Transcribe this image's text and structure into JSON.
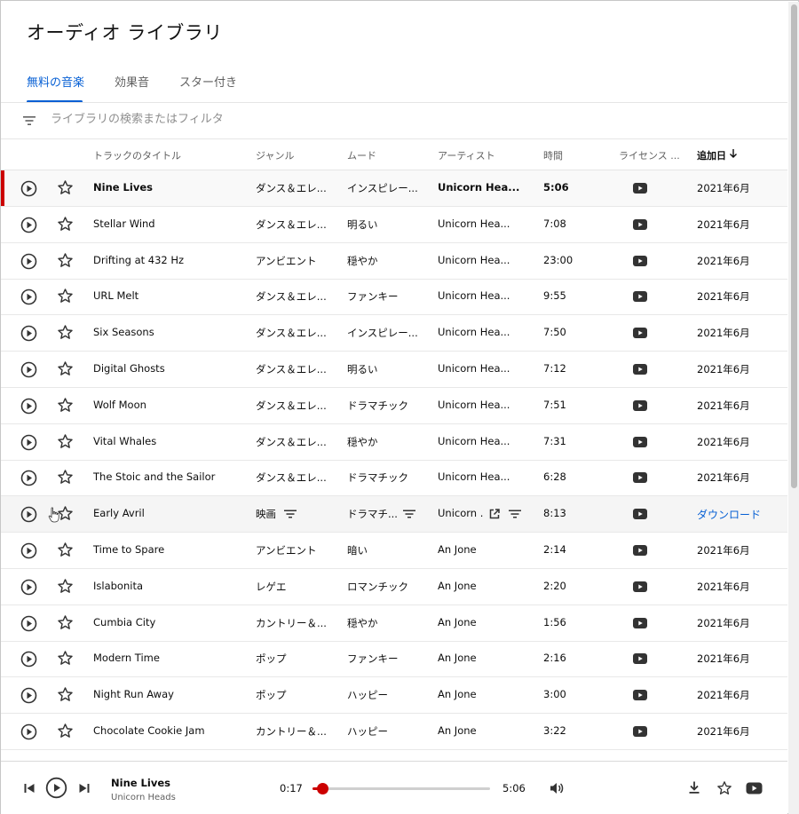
{
  "page": {
    "title": "オーディオ ライブラリ"
  },
  "tabs": [
    {
      "label": "無料の音楽",
      "active": true
    },
    {
      "label": "効果音",
      "active": false
    },
    {
      "label": "スター付き",
      "active": false
    }
  ],
  "filter": {
    "placeholder": "ライブラリの検索またはフィルタ"
  },
  "columns": {
    "title": "トラックのタイトル",
    "genre": "ジャンル",
    "mood": "ムード",
    "artist": "アーティスト",
    "duration": "時間",
    "license": "ライセンス ...",
    "added": "追加日"
  },
  "tracks": [
    {
      "title": "Nine Lives",
      "genre": "ダンス＆エレ...",
      "mood": "インスピレー...",
      "artist": "Unicorn Hea...",
      "duration": "5:06",
      "added": "2021年6月"
    },
    {
      "title": "Stellar Wind",
      "genre": "ダンス＆エレ...",
      "mood": "明るい",
      "artist": "Unicorn Hea...",
      "duration": "7:08",
      "added": "2021年6月"
    },
    {
      "title": "Drifting at 432 Hz",
      "genre": "アンビエント",
      "mood": "穏やか",
      "artist": "Unicorn Hea...",
      "duration": "23:00",
      "added": "2021年6月"
    },
    {
      "title": "URL Melt",
      "genre": "ダンス＆エレ...",
      "mood": "ファンキー",
      "artist": "Unicorn Hea...",
      "duration": "9:55",
      "added": "2021年6月"
    },
    {
      "title": "Six Seasons",
      "genre": "ダンス＆エレ...",
      "mood": "インスピレー...",
      "artist": "Unicorn Hea...",
      "duration": "7:50",
      "added": "2021年6月"
    },
    {
      "title": "Digital Ghosts",
      "genre": "ダンス＆エレ...",
      "mood": "明るい",
      "artist": "Unicorn Hea...",
      "duration": "7:12",
      "added": "2021年6月"
    },
    {
      "title": "Wolf Moon",
      "genre": "ダンス＆エレ...",
      "mood": "ドラマチック",
      "artist": "Unicorn Hea...",
      "duration": "7:51",
      "added": "2021年6月"
    },
    {
      "title": "Vital Whales",
      "genre": "ダンス＆エレ...",
      "mood": "穏やか",
      "artist": "Unicorn Hea...",
      "duration": "7:31",
      "added": "2021年6月"
    },
    {
      "title": "The Stoic and the Sailor",
      "genre": "ダンス＆エレ...",
      "mood": "ドラマチック",
      "artist": "Unicorn Hea...",
      "duration": "6:28",
      "added": "2021年6月"
    },
    {
      "title": "Early Avril",
      "genre": "映画",
      "mood": "ドラマチ...",
      "artist": "Unicorn ...",
      "duration": "8:13",
      "added": "ダウンロード"
    },
    {
      "title": "Time to Spare",
      "genre": "アンビエント",
      "mood": "暗い",
      "artist": "An Jone",
      "duration": "2:14",
      "added": "2021年6月"
    },
    {
      "title": "Islabonita",
      "genre": "レゲエ",
      "mood": "ロマンチック",
      "artist": "An Jone",
      "duration": "2:20",
      "added": "2021年6月"
    },
    {
      "title": "Cumbia City",
      "genre": "カントリー＆...",
      "mood": "穏やか",
      "artist": "An Jone",
      "duration": "1:56",
      "added": "2021年6月"
    },
    {
      "title": "Modern Time",
      "genre": "ポップ",
      "mood": "ファンキー",
      "artist": "An Jone",
      "duration": "2:16",
      "added": "2021年6月"
    },
    {
      "title": "Night Run Away",
      "genre": "ポップ",
      "mood": "ハッピー",
      "artist": "An Jone",
      "duration": "3:00",
      "added": "2021年6月"
    },
    {
      "title": "Chocolate Cookie Jam",
      "genre": "カントリー＆...",
      "mood": "ハッピー",
      "artist": "An Jone",
      "duration": "3:22",
      "added": "2021年6月"
    }
  ],
  "selected_index": 0,
  "hover_index": 9,
  "player": {
    "title": "Nine Lives",
    "artist": "Unicorn Heads",
    "elapsed": "0:17",
    "total": "5:06",
    "progress": 0.055
  },
  "colors": {
    "accent": "#065fd4",
    "brand_red": "#cc0000",
    "text": "#0d0d0d",
    "muted": "#606060"
  }
}
